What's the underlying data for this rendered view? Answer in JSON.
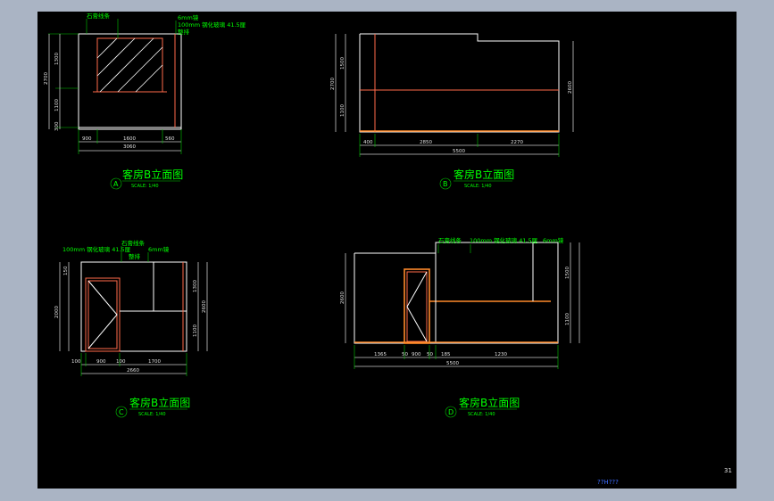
{
  "elevations": [
    {
      "title": "客房B立面图",
      "scale": "SCALE: 1/40",
      "marker": "A",
      "dims_h": [
        "900",
        "1600",
        "560",
        "3060"
      ],
      "dims_v": [
        "1300",
        "1100",
        "300",
        "2700"
      ],
      "notes": [
        "石膏线条",
        "6mm镜",
        "100mm 钢化玻璃 41.5厘",
        "整排"
      ]
    },
    {
      "title": "客房B立面图",
      "scale": "SCALE: 1/40",
      "marker": "B",
      "dims_h": [
        "400",
        "2850",
        "2270",
        "5500"
      ],
      "dims_v": [
        "1500",
        "1100",
        "2700",
        "2600"
      ],
      "notes": []
    },
    {
      "title": "客房B立面图",
      "scale": "SCALE: 1/40",
      "marker": "C",
      "dims_h": [
        "100",
        "900",
        "100",
        "1700",
        "2660"
      ],
      "dims_v": [
        "150",
        "2000",
        "1300",
        "1100",
        "2600"
      ],
      "notes": [
        "100mm 钢化玻璃 41.5厘",
        "石膏线条",
        "6mm镜",
        "整排"
      ]
    },
    {
      "title": "客房B立面图",
      "scale": "SCALE: 1/40",
      "marker": "D",
      "dims_h": [
        "1365",
        "50",
        "900",
        "50",
        "185",
        "1230",
        "5500"
      ],
      "dims_v": [
        "2600",
        "1500",
        "1100"
      ],
      "notes": [
        "石膏线条",
        "100mm 钢化玻璃 41.5厘",
        "6mm镜"
      ]
    }
  ],
  "sheet_number": "31",
  "footer_text": "??H???"
}
